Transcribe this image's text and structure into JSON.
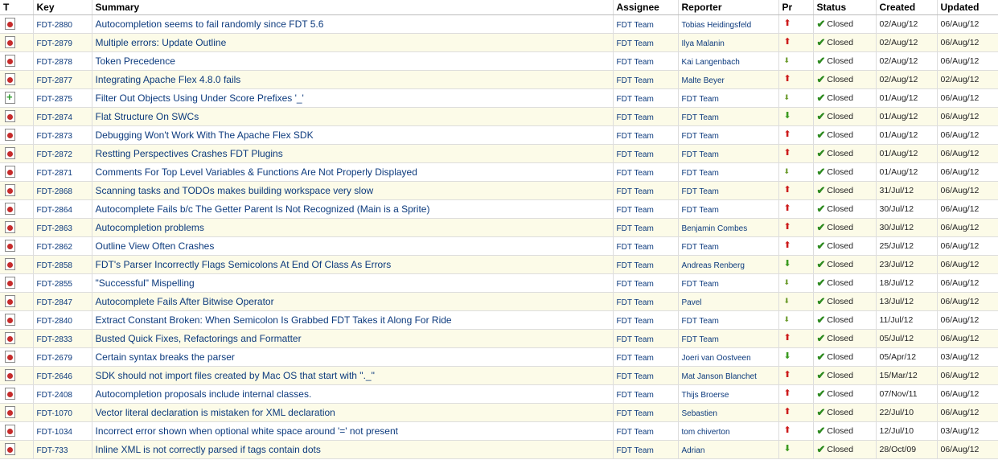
{
  "headers": {
    "t": "T",
    "key": "Key",
    "summary": "Summary",
    "assignee": "Assignee",
    "reporter": "Reporter",
    "pr": "Pr",
    "status": "Status",
    "created": "Created",
    "updated": "Updated"
  },
  "rows": [
    {
      "type": "bug",
      "key": "FDT-2880",
      "summary": "Autocompletion seems to fail randomly since FDT 5.6",
      "assignee": "FDT Team",
      "reporter": "Tobias Heidingsfeld",
      "priority": "major",
      "status": "Closed",
      "created": "02/Aug/12",
      "updated": "06/Aug/12"
    },
    {
      "type": "bug",
      "key": "FDT-2879",
      "summary": "Multiple errors: Update Outline",
      "assignee": "FDT Team",
      "reporter": "Ilya Malanin",
      "priority": "major",
      "status": "Closed",
      "created": "02/Aug/12",
      "updated": "06/Aug/12"
    },
    {
      "type": "bug",
      "key": "FDT-2878",
      "summary": "Token Precedence",
      "assignee": "FDT Team",
      "reporter": "Kai Langenbach",
      "priority": "trivial",
      "status": "Closed",
      "created": "02/Aug/12",
      "updated": "06/Aug/12"
    },
    {
      "type": "bug",
      "key": "FDT-2877",
      "summary": "Integrating Apache Flex 4.8.0 fails",
      "assignee": "FDT Team",
      "reporter": "Malte Beyer",
      "priority": "major",
      "status": "Closed",
      "created": "02/Aug/12",
      "updated": "02/Aug/12"
    },
    {
      "type": "feature",
      "key": "FDT-2875",
      "summary": "Filter Out Objects Using Under Score Prefixes '_'",
      "assignee": "FDT Team",
      "reporter": "FDT Team",
      "priority": "trivial",
      "status": "Closed",
      "created": "01/Aug/12",
      "updated": "06/Aug/12"
    },
    {
      "type": "bug",
      "key": "FDT-2874",
      "summary": "Flat Structure On SWCs",
      "assignee": "FDT Team",
      "reporter": "FDT Team",
      "priority": "minor",
      "status": "Closed",
      "created": "01/Aug/12",
      "updated": "06/Aug/12"
    },
    {
      "type": "bug",
      "key": "FDT-2873",
      "summary": "Debugging Won't Work With The Apache Flex SDK",
      "assignee": "FDT Team",
      "reporter": "FDT Team",
      "priority": "critical",
      "status": "Closed",
      "created": "01/Aug/12",
      "updated": "06/Aug/12"
    },
    {
      "type": "bug",
      "key": "FDT-2872",
      "summary": "Restting Perspectives Crashes FDT Plugins",
      "assignee": "FDT Team",
      "reporter": "FDT Team",
      "priority": "major",
      "status": "Closed",
      "created": "01/Aug/12",
      "updated": "06/Aug/12"
    },
    {
      "type": "bug",
      "key": "FDT-2871",
      "summary": "Comments For Top Level Variables & Functions Are Not Properly Displayed",
      "assignee": "FDT Team",
      "reporter": "FDT Team",
      "priority": "trivial",
      "status": "Closed",
      "created": "01/Aug/12",
      "updated": "06/Aug/12"
    },
    {
      "type": "bug",
      "key": "FDT-2868",
      "summary": "Scanning tasks and TODOs makes building workspace very slow",
      "assignee": "FDT Team",
      "reporter": "FDT Team",
      "priority": "major",
      "status": "Closed",
      "created": "31/Jul/12",
      "updated": "06/Aug/12"
    },
    {
      "type": "bug",
      "key": "FDT-2864",
      "summary": "Autocomplete Fails b/c The Getter Parent Is Not Recognized (Main is a Sprite)",
      "assignee": "FDT Team",
      "reporter": "FDT Team",
      "priority": "major",
      "status": "Closed",
      "created": "30/Jul/12",
      "updated": "06/Aug/12"
    },
    {
      "type": "bug",
      "key": "FDT-2863",
      "summary": "Autocompletion problems",
      "assignee": "FDT Team",
      "reporter": "Benjamin Combes",
      "priority": "critical",
      "status": "Closed",
      "created": "30/Jul/12",
      "updated": "06/Aug/12"
    },
    {
      "type": "bug",
      "key": "FDT-2862",
      "summary": "Outline View Often Crashes",
      "assignee": "FDT Team",
      "reporter": "FDT Team",
      "priority": "critical",
      "status": "Closed",
      "created": "25/Jul/12",
      "updated": "06/Aug/12"
    },
    {
      "type": "bug",
      "key": "FDT-2858",
      "summary": "FDT's Parser Incorrectly Flags Semicolons At End Of Class As Errors",
      "assignee": "FDT Team",
      "reporter": "Andreas Renberg",
      "priority": "minor",
      "status": "Closed",
      "created": "23/Jul/12",
      "updated": "06/Aug/12"
    },
    {
      "type": "bug",
      "key": "FDT-2855",
      "summary": "\"Successful\" Mispelling",
      "assignee": "FDT Team",
      "reporter": "FDT Team",
      "priority": "trivial",
      "status": "Closed",
      "created": "18/Jul/12",
      "updated": "06/Aug/12"
    },
    {
      "type": "bug",
      "key": "FDT-2847",
      "summary": "Autocomplete Fails After Bitwise Operator",
      "assignee": "FDT Team",
      "reporter": "Pavel",
      "priority": "trivial",
      "status": "Closed",
      "created": "13/Jul/12",
      "updated": "06/Aug/12"
    },
    {
      "type": "bug",
      "key": "FDT-2840",
      "summary": "Extract Constant Broken: When Semicolon Is Grabbed FDT Takes it Along For Ride",
      "assignee": "FDT Team",
      "reporter": "FDT Team",
      "priority": "trivial",
      "status": "Closed",
      "created": "11/Jul/12",
      "updated": "06/Aug/12"
    },
    {
      "type": "bug",
      "key": "FDT-2833",
      "summary": "Busted Quick Fixes, Refactorings and Formatter",
      "assignee": "FDT Team",
      "reporter": "FDT Team",
      "priority": "major",
      "status": "Closed",
      "created": "05/Jul/12",
      "updated": "06/Aug/12"
    },
    {
      "type": "bug",
      "key": "FDT-2679",
      "summary": "Certain syntax breaks the parser",
      "assignee": "FDT Team",
      "reporter": "Joeri van Oostveen",
      "priority": "minor",
      "status": "Closed",
      "created": "05/Apr/12",
      "updated": "03/Aug/12"
    },
    {
      "type": "bug",
      "key": "FDT-2646",
      "summary": "SDK should not import files created by Mac OS that start with \"._\"",
      "assignee": "FDT Team",
      "reporter": "Mat Janson Blanchet",
      "priority": "major",
      "status": "Closed",
      "created": "15/Mar/12",
      "updated": "06/Aug/12"
    },
    {
      "type": "bug",
      "key": "FDT-2408",
      "summary": "Autocompletion proposals include internal classes.",
      "assignee": "FDT Team",
      "reporter": "Thijs Broerse",
      "priority": "major",
      "status": "Closed",
      "created": "07/Nov/11",
      "updated": "06/Aug/12"
    },
    {
      "type": "bug",
      "key": "FDT-1070",
      "summary": "Vector literal declaration is mistaken for XML declaration",
      "assignee": "FDT Team",
      "reporter": "Sebastien",
      "priority": "major",
      "status": "Closed",
      "created": "22/Jul/10",
      "updated": "06/Aug/12"
    },
    {
      "type": "bug",
      "key": "FDT-1034",
      "summary": "Incorrect error shown when optional white space around '=' not present",
      "assignee": "FDT Team",
      "reporter": "tom chiverton",
      "priority": "major",
      "status": "Closed",
      "created": "12/Jul/10",
      "updated": "03/Aug/12"
    },
    {
      "type": "bug",
      "key": "FDT-733",
      "summary": "Inline XML is not correctly parsed if tags contain dots",
      "assignee": "FDT Team",
      "reporter": "Adrian",
      "priority": "minor",
      "status": "Closed",
      "created": "28/Oct/09",
      "updated": "06/Aug/12"
    }
  ]
}
